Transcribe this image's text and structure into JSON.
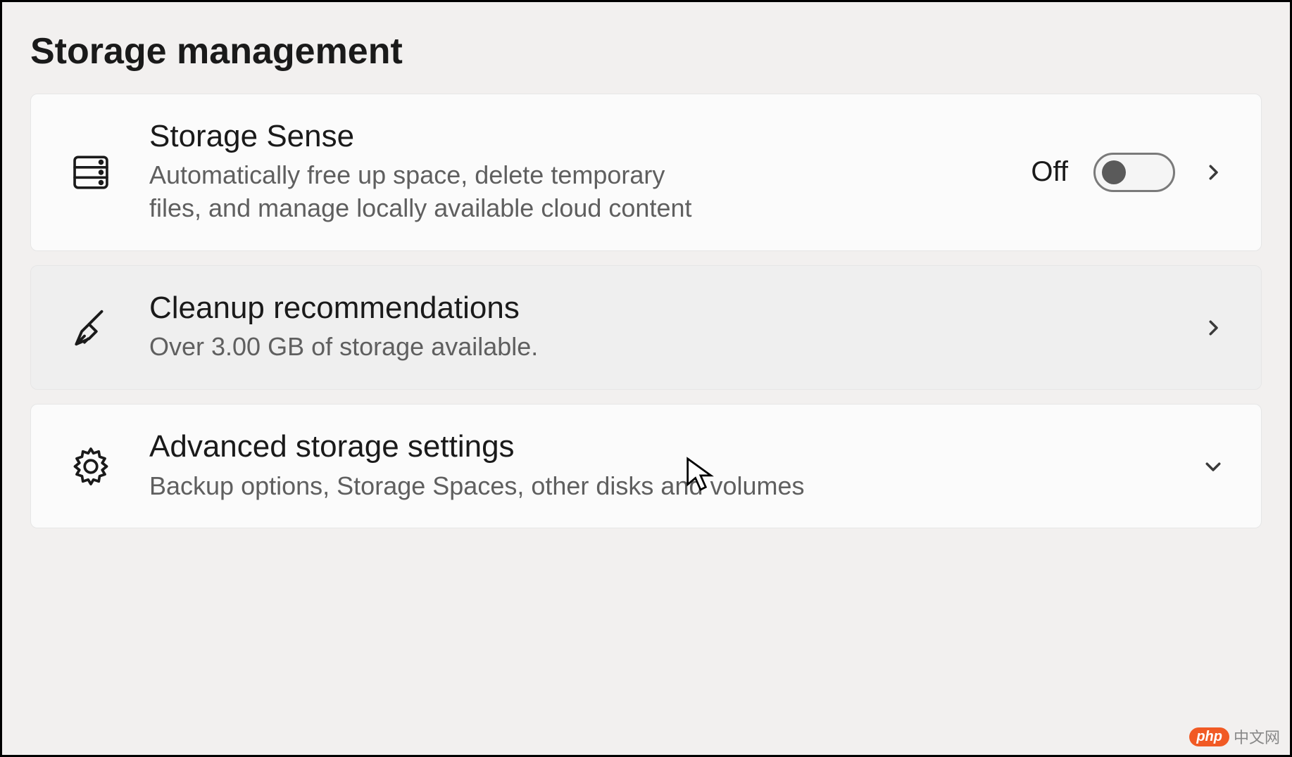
{
  "section_title": "Storage management",
  "items": [
    {
      "icon": "storage-drive-icon",
      "title": "Storage Sense",
      "description": "Automatically free up space, delete temporary files, and manage locally available cloud content",
      "toggle_state": "Off",
      "action_icon": "chevron-right-icon"
    },
    {
      "icon": "broom-icon",
      "title": "Cleanup recommendations",
      "description": "Over 3.00 GB of storage available.",
      "action_icon": "chevron-right-icon"
    },
    {
      "icon": "gear-icon",
      "title": "Advanced storage settings",
      "description": "Backup options, Storage Spaces, other disks and volumes",
      "action_icon": "chevron-down-icon"
    }
  ],
  "watermark": {
    "badge": "php",
    "text": "中文网"
  }
}
